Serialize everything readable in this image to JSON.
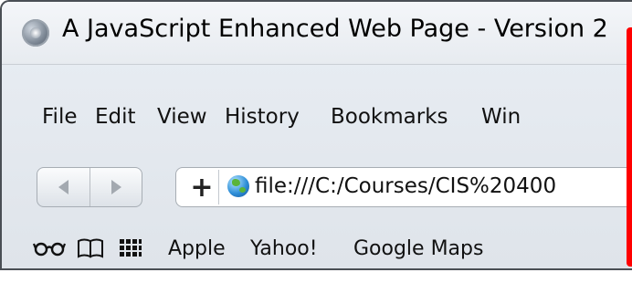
{
  "window": {
    "title": "A JavaScript Enhanced Web Page - Version 2",
    "app_icon": "safari-compass-icon"
  },
  "menu": {
    "items": [
      {
        "label": "File"
      },
      {
        "label": "Edit"
      },
      {
        "label": "View"
      },
      {
        "label": "History"
      },
      {
        "label": "Bookmarks"
      },
      {
        "label": "Win"
      }
    ]
  },
  "navigation": {
    "back_icon": "back-arrow-icon",
    "forward_icon": "forward-arrow-icon",
    "add_label": "+",
    "site_icon": "globe-icon",
    "url": "file:///C:/Courses/CIS%20400"
  },
  "bookmarks_bar": {
    "icons": [
      "reading-list-icon",
      "bookmarks-book-icon",
      "top-sites-grid-icon"
    ],
    "items": [
      {
        "label": "Apple"
      },
      {
        "label": "Yahoo!"
      },
      {
        "label": "Google Maps"
      }
    ]
  },
  "colors": {
    "highlight_border": "#ff0000",
    "chrome_background": "#e4e9ef"
  }
}
